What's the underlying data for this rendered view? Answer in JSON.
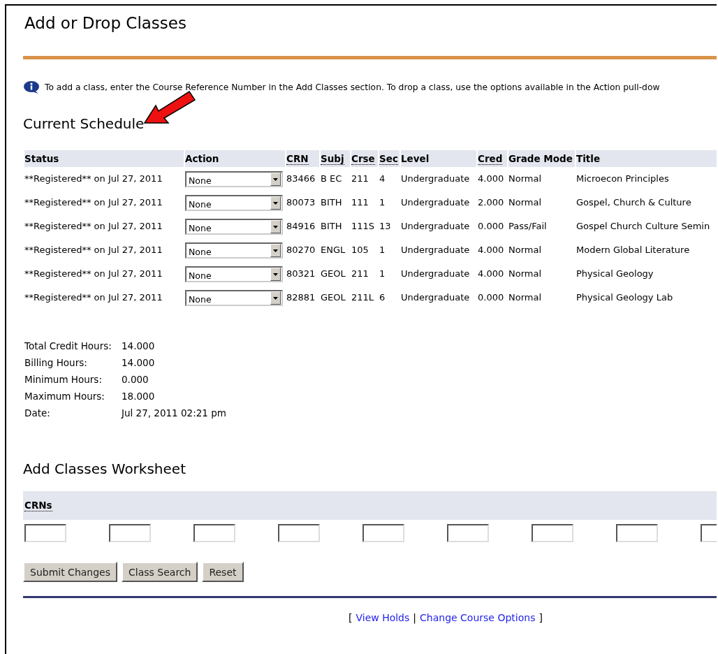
{
  "page": {
    "title": "Add or Drop Classes"
  },
  "info_message": "To add a class, enter the Course Reference Number in the Add Classes section. To drop a class, use the options available in the Action pull-dow",
  "current_schedule": {
    "heading": "Current Schedule",
    "columns": [
      {
        "label": "Status",
        "abbreviation": false
      },
      {
        "label": "Action",
        "abbreviation": false
      },
      {
        "label": "CRN",
        "abbreviation": true
      },
      {
        "label": "Subj",
        "abbreviation": true
      },
      {
        "label": "Crse",
        "abbreviation": true
      },
      {
        "label": "Sec",
        "abbreviation": true
      },
      {
        "label": "Level",
        "abbreviation": false
      },
      {
        "label": "Cred",
        "abbreviation": true
      },
      {
        "label": "Grade Mode",
        "abbreviation": false
      },
      {
        "label": "Title",
        "abbreviation": false
      }
    ],
    "rows": [
      {
        "status": "**Registered** on Jul 27, 2011",
        "action": "None",
        "crn": "83466",
        "subj": "B EC",
        "crse": "211",
        "sec": "4",
        "level": "Undergraduate",
        "cred": "4.000",
        "grade_mode": "Normal",
        "title": "Microecon Principles"
      },
      {
        "status": "**Registered** on Jul 27, 2011",
        "action": "None",
        "crn": "80073",
        "subj": "BITH",
        "crse": "111",
        "sec": "1",
        "level": "Undergraduate",
        "cred": "2.000",
        "grade_mode": "Normal",
        "title": "Gospel, Church & Culture"
      },
      {
        "status": "**Registered** on Jul 27, 2011",
        "action": "None",
        "crn": "84916",
        "subj": "BITH",
        "crse": "111S",
        "sec": "13",
        "level": "Undergraduate",
        "cred": "0.000",
        "grade_mode": "Pass/Fail",
        "title": "Gospel Church Culture Semin"
      },
      {
        "status": "**Registered** on Jul 27, 2011",
        "action": "None",
        "crn": "80270",
        "subj": "ENGL",
        "crse": "105",
        "sec": "1",
        "level": "Undergraduate",
        "cred": "4.000",
        "grade_mode": "Normal",
        "title": "Modern Global Literature"
      },
      {
        "status": "**Registered** on Jul 27, 2011",
        "action": "None",
        "crn": "80321",
        "subj": "GEOL",
        "crse": "211",
        "sec": "1",
        "level": "Undergraduate",
        "cred": "4.000",
        "grade_mode": "Normal",
        "title": "Physical Geology"
      },
      {
        "status": "**Registered** on Jul 27, 2011",
        "action": "None",
        "crn": "82881",
        "subj": "GEOL",
        "crse": "211L",
        "sec": "6",
        "level": "Undergraduate",
        "cred": "0.000",
        "grade_mode": "Normal",
        "title": "Physical Geology Lab"
      }
    ]
  },
  "summary": [
    {
      "label": "Total Credit Hours:",
      "value": "14.000"
    },
    {
      "label": "Billing Hours:",
      "value": "14.000"
    },
    {
      "label": "Minimum Hours:",
      "value": "0.000"
    },
    {
      "label": "Maximum Hours:",
      "value": "18.000"
    },
    {
      "label": "Date:",
      "value": "Jul 27, 2011 02:21 pm"
    }
  ],
  "add_worksheet": {
    "heading": "Add Classes Worksheet",
    "column": "CRNs",
    "fields": [
      {
        "kind": "text"
      },
      {
        "kind": "text"
      },
      {
        "kind": "text"
      },
      {
        "kind": "text"
      },
      {
        "kind": "text"
      },
      {
        "kind": "text"
      },
      {
        "kind": "text"
      },
      {
        "kind": "text"
      },
      {
        "kind": "text"
      }
    ]
  },
  "buttons": [
    "Submit Changes",
    "Class Search",
    "Reset"
  ],
  "footer": {
    "open": "[",
    "links": [
      "View Holds",
      "Change Course Options"
    ],
    "separator": "|",
    "close": "]"
  }
}
